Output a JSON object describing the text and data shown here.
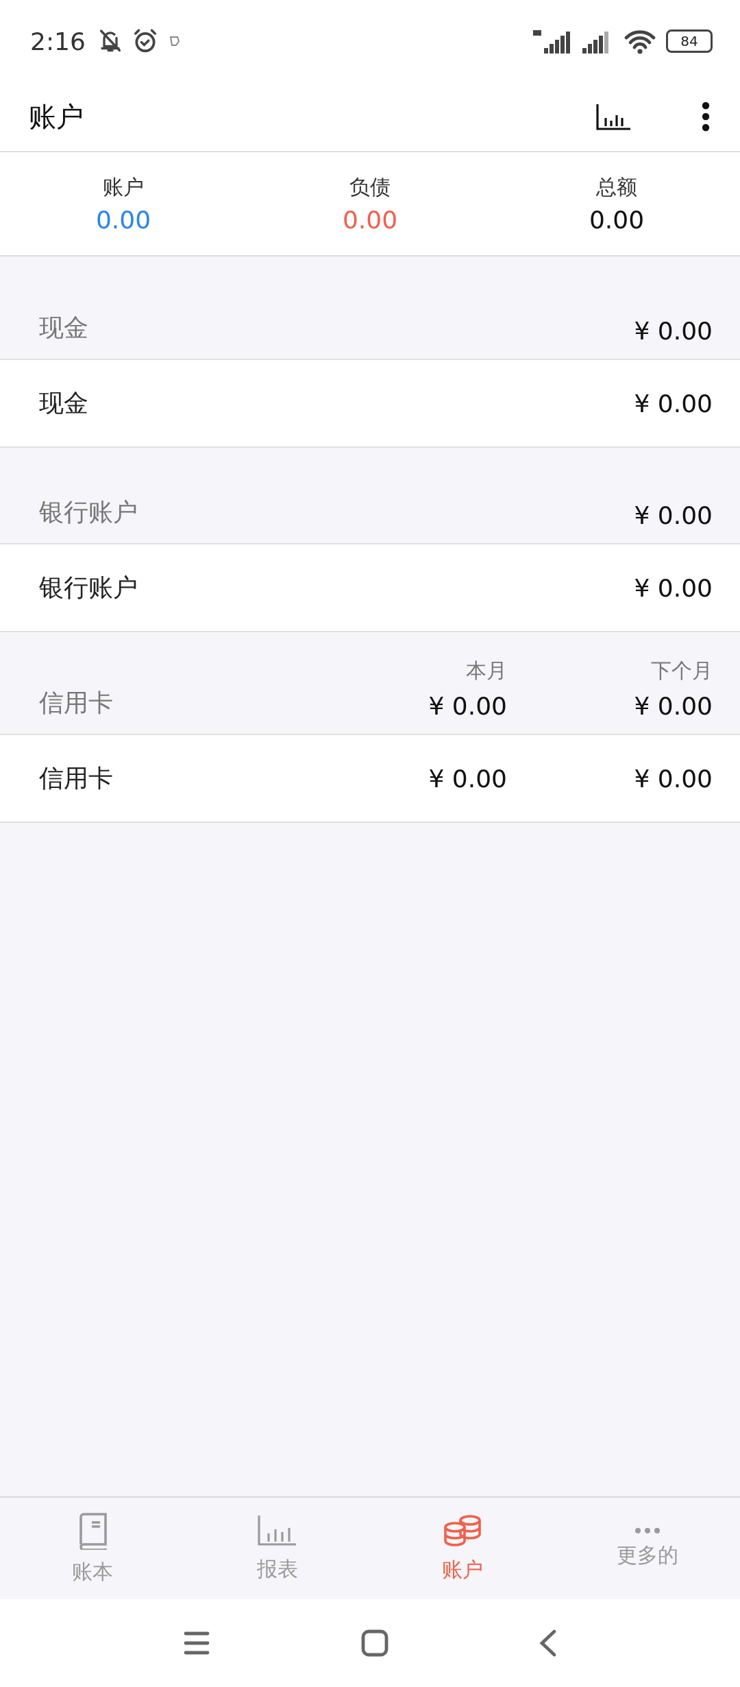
{
  "status_bar": {
    "time": "2:16",
    "battery": "84"
  },
  "app_bar": {
    "title": "账户"
  },
  "summary": [
    {
      "label": "账户",
      "value": "0.00",
      "kind": "asset"
    },
    {
      "label": "负债",
      "value": "0.00",
      "kind": "liability"
    },
    {
      "label": "总额",
      "value": "0.00",
      "kind": "total"
    }
  ],
  "sections": [
    {
      "title": "现金",
      "totals": [
        "¥ 0.00"
      ],
      "accounts": [
        {
          "name": "现金",
          "amounts": [
            "¥ 0.00"
          ]
        }
      ]
    },
    {
      "title": "银行账户",
      "totals": [
        "¥ 0.00"
      ],
      "accounts": [
        {
          "name": "银行账户",
          "amounts": [
            "¥ 0.00"
          ]
        }
      ]
    },
    {
      "title": "信用卡",
      "columns": [
        "本月",
        "下个月"
      ],
      "totals": [
        "¥ 0.00",
        "¥ 0.00"
      ],
      "accounts": [
        {
          "name": "信用卡",
          "amounts": [
            "¥ 0.00",
            "¥ 0.00"
          ]
        }
      ]
    }
  ],
  "bottom_nav": [
    {
      "label": "账本",
      "selected": false
    },
    {
      "label": "报表",
      "selected": false
    },
    {
      "label": "账户",
      "selected": true
    },
    {
      "label": "更多的",
      "selected": false
    }
  ]
}
